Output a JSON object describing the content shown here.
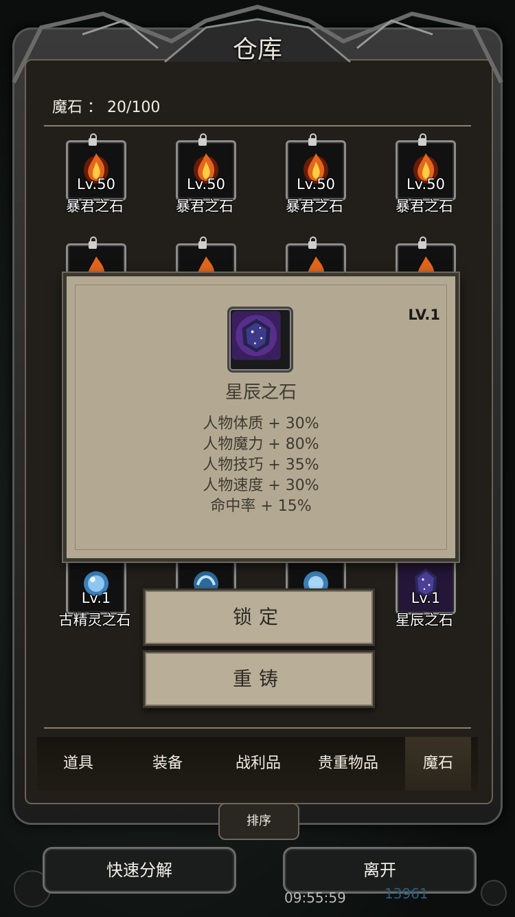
{
  "window": {
    "title": "仓库"
  },
  "counter": {
    "label": "魔石",
    "value": "20/100"
  },
  "colors": {
    "fire": "#e2661c",
    "frost": "#8ec6f0",
    "star": "#7a4fc2",
    "panel": "#b3a993"
  },
  "grid": {
    "row1": [
      {
        "level": "Lv.50",
        "name": "暴君之石",
        "icon": "fire-stone-icon",
        "locked": true
      },
      {
        "level": "Lv.50",
        "name": "暴君之石",
        "icon": "fire-stone-icon",
        "locked": true
      },
      {
        "level": "Lv.50",
        "name": "暴君之石",
        "icon": "fire-stone-icon",
        "locked": true
      },
      {
        "level": "Lv.50",
        "name": "暴君之石",
        "icon": "fire-stone-icon",
        "locked": true
      }
    ],
    "bottom_row": [
      {
        "level": "Lv.1",
        "name": "古精灵之石",
        "icon": "frost-stone-icon"
      },
      {
        "level": "",
        "name": "",
        "icon": "frost-stone-icon"
      },
      {
        "level": "",
        "name": "",
        "icon": "frost-stone-icon"
      },
      {
        "level": "Lv.1",
        "name": "星辰之石",
        "icon": "star-stone-icon"
      }
    ]
  },
  "detail": {
    "level": "LV.1",
    "name": "星辰之石",
    "icon": "star-stone-icon",
    "stats": [
      "人物体质 + 30%",
      "人物魔力 + 80%",
      "人物技巧 + 35%",
      "人物速度 + 30%",
      "命中率 + 15%"
    ]
  },
  "actions": {
    "lock": "锁定",
    "reforge": "重铸"
  },
  "tabs": [
    "道具",
    "装备",
    "战利品",
    "贵重物品",
    "魔石"
  ],
  "active_tab": "魔石",
  "sort_label": "排序",
  "bottom": {
    "quick_decompose": "快速分解",
    "leave": "离开",
    "clock": "09:55:59",
    "currency": "13961"
  }
}
